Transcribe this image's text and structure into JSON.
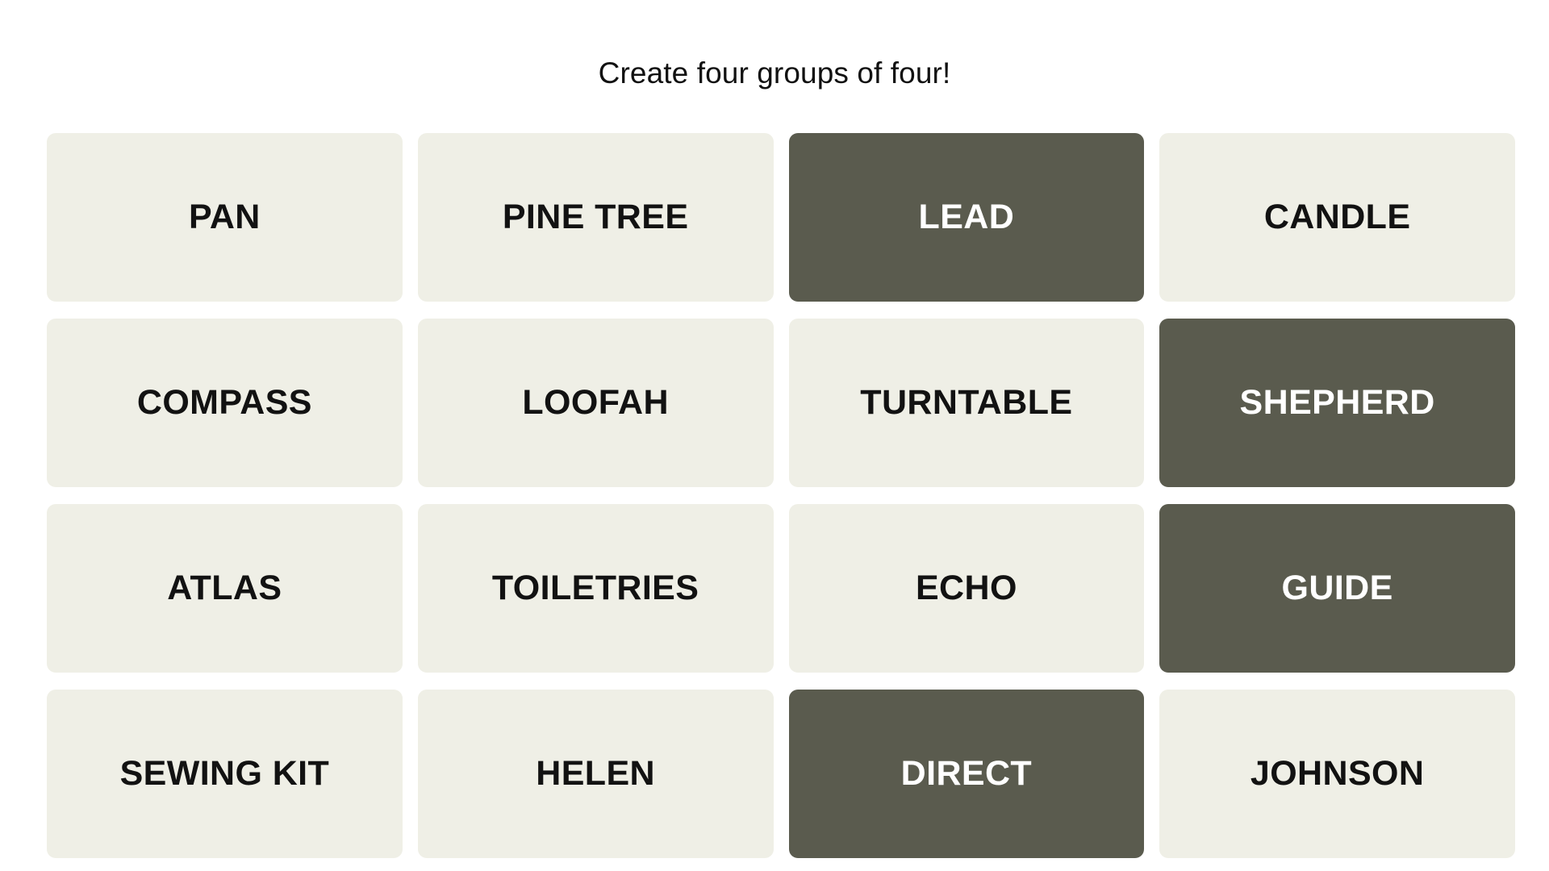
{
  "header": {
    "instruction": "Create four groups of four!"
  },
  "colors": {
    "page_background": "#ffffff",
    "tile_unselected_bg": "#efefe6",
    "tile_unselected_text": "#121212",
    "tile_selected_bg": "#5a5b4e",
    "tile_selected_text": "#ffffff",
    "title_text": "#111111"
  },
  "board": {
    "rows": 4,
    "columns": 4,
    "selected_count": 4,
    "tiles": [
      {
        "label": "PAN",
        "selected": false,
        "row": 1,
        "column": 1
      },
      {
        "label": "PINE TREE",
        "selected": false,
        "row": 1,
        "column": 2
      },
      {
        "label": "LEAD",
        "selected": true,
        "row": 1,
        "column": 3
      },
      {
        "label": "CANDLE",
        "selected": false,
        "row": 1,
        "column": 4
      },
      {
        "label": "COMPASS",
        "selected": false,
        "row": 2,
        "column": 1
      },
      {
        "label": "LOOFAH",
        "selected": false,
        "row": 2,
        "column": 2
      },
      {
        "label": "TURNTABLE",
        "selected": false,
        "row": 2,
        "column": 3
      },
      {
        "label": "SHEPHERD",
        "selected": true,
        "row": 2,
        "column": 4
      },
      {
        "label": "ATLAS",
        "selected": false,
        "row": 3,
        "column": 1
      },
      {
        "label": "TOILETRIES",
        "selected": false,
        "row": 3,
        "column": 2
      },
      {
        "label": "ECHO",
        "selected": false,
        "row": 3,
        "column": 3
      },
      {
        "label": "GUIDE",
        "selected": true,
        "row": 3,
        "column": 4
      },
      {
        "label": "SEWING KIT",
        "selected": false,
        "row": 4,
        "column": 1
      },
      {
        "label": "HELEN",
        "selected": false,
        "row": 4,
        "column": 2
      },
      {
        "label": "DIRECT",
        "selected": true,
        "row": 4,
        "column": 3
      },
      {
        "label": "JOHNSON",
        "selected": false,
        "row": 4,
        "column": 4
      }
    ]
  }
}
